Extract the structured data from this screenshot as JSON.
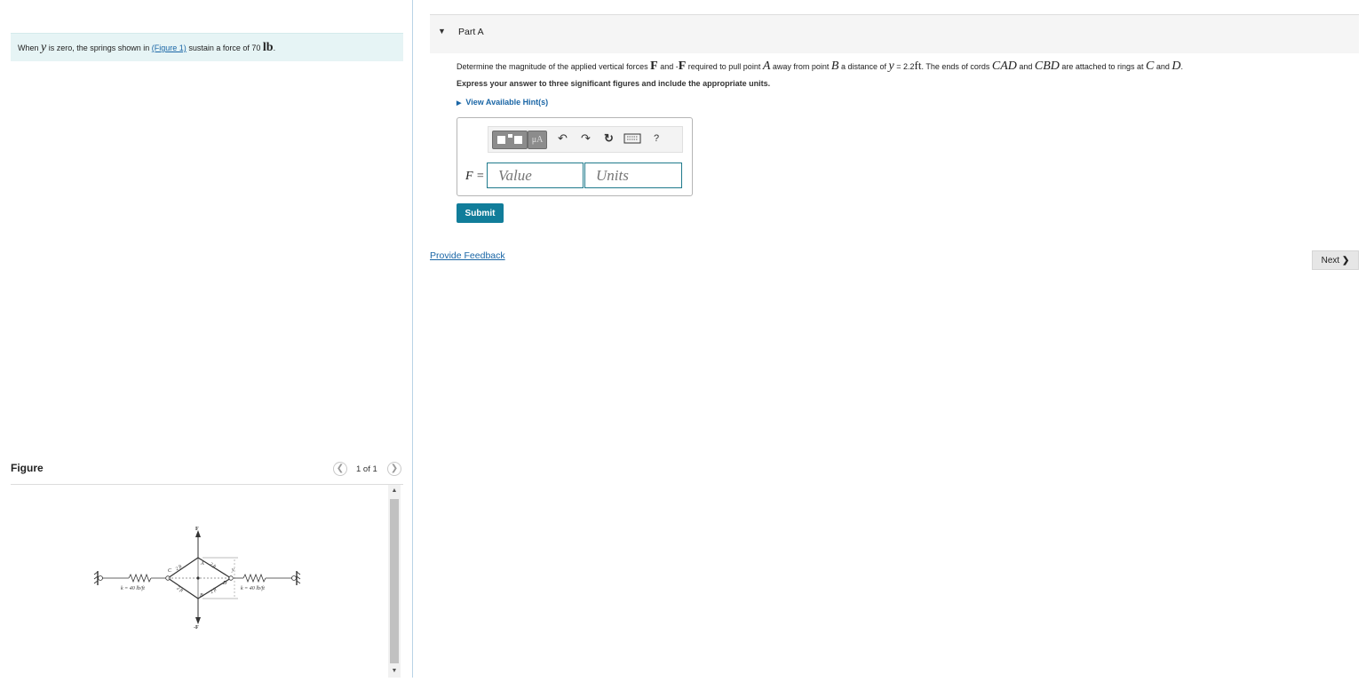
{
  "intro": {
    "prefix": "When ",
    "var_y": "y",
    "mid": " is zero, the springs shown in ",
    "link": "(Figure 1)",
    "suffix": " sustain a force of 70 ",
    "unit": "lb",
    "end": "."
  },
  "figure_panel": {
    "title": "Figure",
    "pager": "1 of 1",
    "prev_icon": "chevron-left-icon",
    "next_icon": "chevron-right-icon"
  },
  "diagram": {
    "force_top": "F",
    "force_bottom": "-F",
    "points": {
      "A": "A",
      "B": "B",
      "C": "C",
      "D": "D"
    },
    "dim_top_left": "2 ft",
    "dim_top_right": "2 ft",
    "dim_bottom_left": "2 ft",
    "dim_bottom_right": "2 ft",
    "var_y": "y",
    "spring_left": "k = 40 lb/ft",
    "spring_right": "k = 40 lb/ft"
  },
  "part": {
    "toggle_icon": "caret-down-icon",
    "title": "Part A"
  },
  "question": {
    "t1": "Determine the magnitude of the applied vertical forces ",
    "F": "F",
    "t2": " and -",
    "F2": "F",
    "t3": " required to pull point ",
    "A": "A",
    "t4": " away from point ",
    "B": "B",
    "t5": " a distance of ",
    "y": "y",
    "t6": " = 2.2",
    "ft": "ft",
    "t7": ". The ends of cords ",
    "CAD": "CAD",
    "t8": " and ",
    "CBD": "CBD",
    "t9": " are attached to rings at ",
    "C": "C",
    "t10": " and ",
    "D": "D",
    "t11": "."
  },
  "instruction": "Express your answer to three significant figures and include the appropriate units.",
  "hints": "View Available Hint(s)",
  "answer": {
    "label": "F =",
    "value_placeholder": "Value",
    "units_placeholder": "Units",
    "toolbar_mu": "μA",
    "toolbar_help": "?"
  },
  "submit_label": "Submit",
  "feedback_label": "Provide Feedback",
  "next_label": "Next",
  "next_icon": "chevron-right-icon",
  "colors": {
    "accent": "#117d9a",
    "link": "#1a66a6",
    "intro_bg": "#e6f4f5"
  }
}
